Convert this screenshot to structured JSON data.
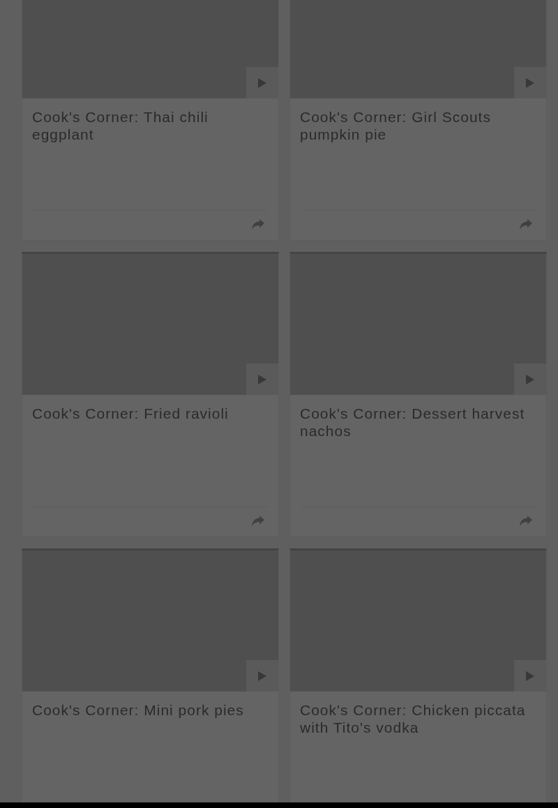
{
  "cards": [
    {
      "title": "Cook's Corner: Thai chili eggplant"
    },
    {
      "title": "Cook's Corner: Girl Scouts pumpkin pie"
    },
    {
      "title": "Cook's Corner: Fried ravioli"
    },
    {
      "title": "Cook's Corner: Dessert harvest nachos"
    },
    {
      "title": "Cook's Corner: Mini pork pies"
    },
    {
      "title": "Cook's Corner: Chicken piccata with Tito's vodka"
    }
  ]
}
